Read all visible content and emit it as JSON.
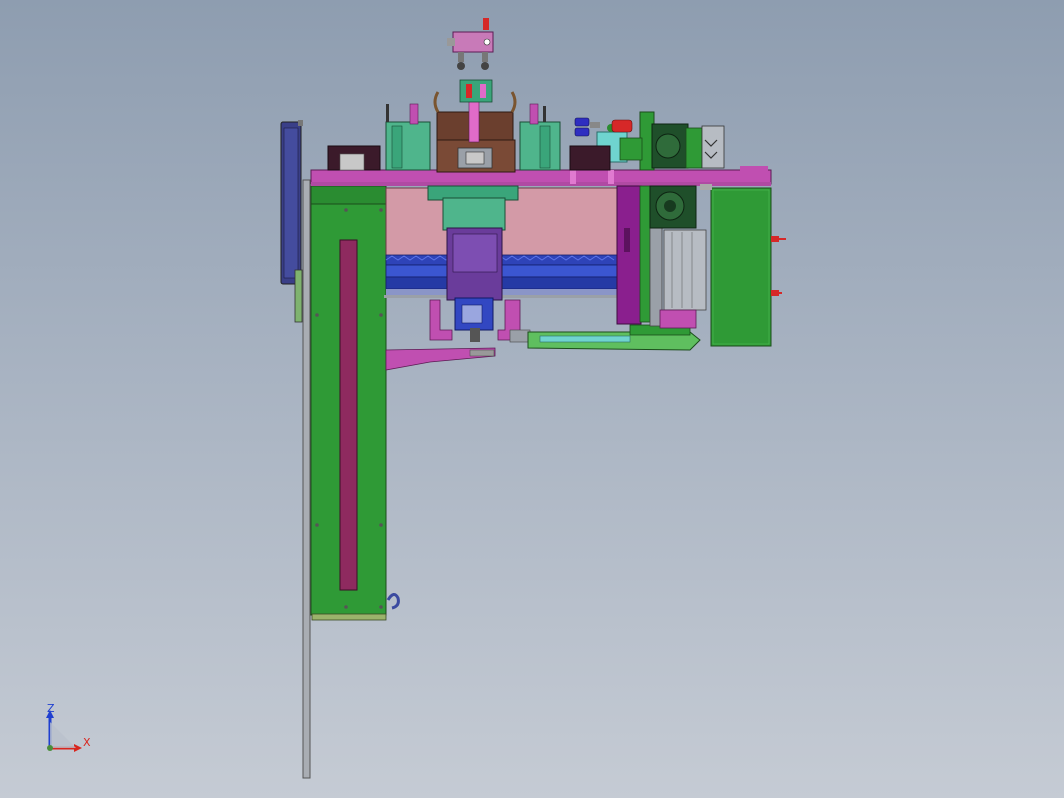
{
  "triad": {
    "z_label": "Z",
    "x_label": "X",
    "colors": {
      "z_axis": "#1f3fd0",
      "x_axis": "#d8261e",
      "origin": "#4b8d3a"
    }
  },
  "colors": {
    "background_top": "#8e9db0",
    "background_bottom": "#c5cbd4",
    "frame_magenta": "#c04fb1",
    "frame_purple": "#8a1f8e",
    "panel_green": "#2f9a36",
    "panel_light_green": "#5fbf5f",
    "slot_maroon": "#8e2a5f",
    "tank_pink": "#d39aa7",
    "tank_blue": "#2e43b8",
    "motor_purple": "#6a3c9b",
    "housing_brown": "#6b3f2e",
    "rail_grey": "#9aa0a8",
    "teal": "#6fd4cf",
    "red_fitting": "#d62828",
    "navy_panel": "#3a3f88"
  }
}
